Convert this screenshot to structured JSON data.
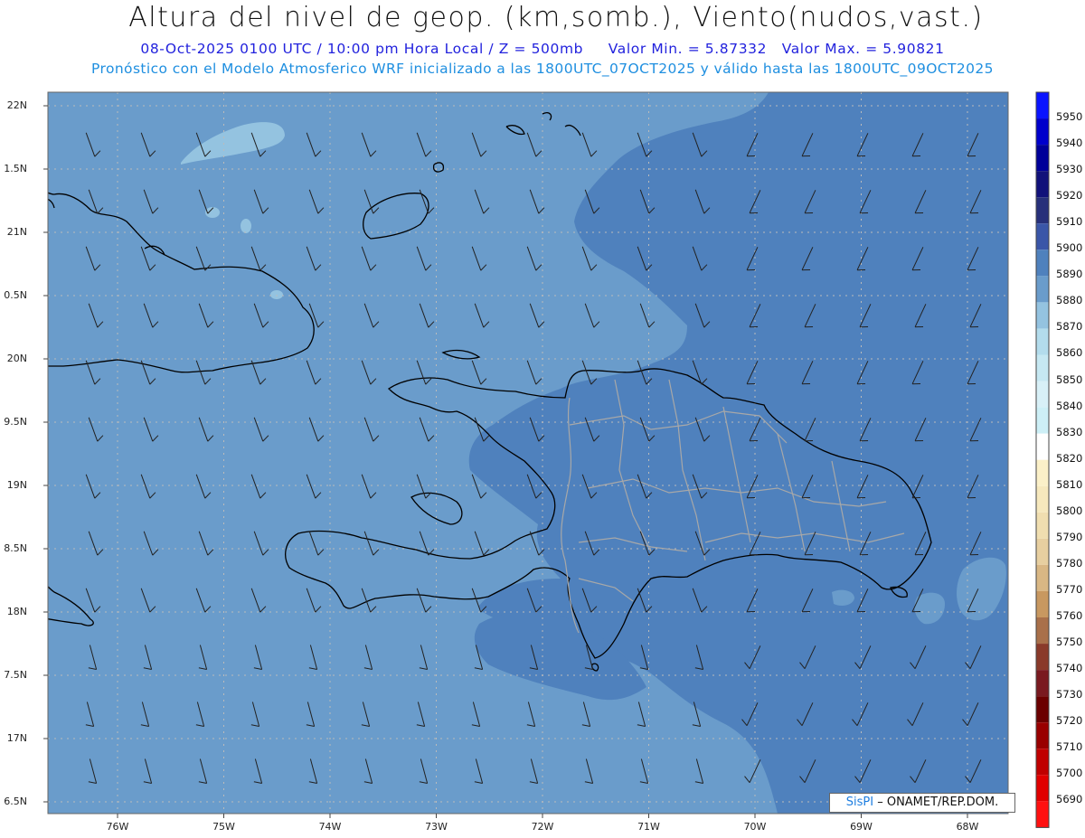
{
  "header": {
    "title": "Altura del nivel de geop. (km,somb.), Viento(nudos,vast.)",
    "date_utc": "08-Oct-2025  0100 UTC",
    "local_time": "/ 10:00 pm Hora Local / Z = 500mb",
    "min_value": "Valor Min. = 5.87332",
    "max_value": "Valor Max. = 5.90821",
    "model_line": "Pronóstico con el Modelo Atmosferico WRF inicializado a las 1800UTC_07OCT2025 y válido hasta las  1800UTC_09OCT2025"
  },
  "map": {
    "lat_labels": [
      "22N",
      "1.5N",
      "21N",
      "0.5N",
      "20N",
      "9.5N",
      "19N",
      "8.5N",
      "18N",
      "7.5N",
      "17N",
      "6.5N"
    ],
    "lon_labels": [
      "76W",
      "75W",
      "74W",
      "73W",
      "72W",
      "71W",
      "70W",
      "69W",
      "68W"
    ],
    "colors": {
      "field_5880": "#6a9ccb",
      "field_5890": "#4f81bd",
      "field_5870": "#94c3e0",
      "coast": "#000000",
      "provinces": "#a8a8a8"
    }
  },
  "colorbar": {
    "levels": [
      {
        "value": "5950",
        "color": "#0a14ff"
      },
      {
        "value": "5940",
        "color": "#0000cc"
      },
      {
        "value": "5930",
        "color": "#000099"
      },
      {
        "value": "5920",
        "color": "#11117a"
      },
      {
        "value": "5910",
        "color": "#27307a"
      },
      {
        "value": "5900",
        "color": "#3a56a8"
      },
      {
        "value": "5890",
        "color": "#4f81bd"
      },
      {
        "value": "5880",
        "color": "#6a9ccb"
      },
      {
        "value": "5870",
        "color": "#94c3e0"
      },
      {
        "value": "5860",
        "color": "#b3dcec"
      },
      {
        "value": "5850",
        "color": "#c6e8f2"
      },
      {
        "value": "5840",
        "color": "#d8f0f7"
      },
      {
        "value": "5830",
        "color": "#cdeff6"
      },
      {
        "value": "5820",
        "color": "#ffffff"
      },
      {
        "value": "5810",
        "color": "#fbf0c8"
      },
      {
        "value": "5800",
        "color": "#f6e8bd"
      },
      {
        "value": "5790",
        "color": "#f0deb0"
      },
      {
        "value": "5780",
        "color": "#e7cfa0"
      },
      {
        "value": "5770",
        "color": "#d9b784"
      },
      {
        "value": "5760",
        "color": "#c89860"
      },
      {
        "value": "5750",
        "color": "#a9704a"
      },
      {
        "value": "5740",
        "color": "#8a3a2a"
      },
      {
        "value": "5730",
        "color": "#7a1a20"
      },
      {
        "value": "5720",
        "color": "#6b0000"
      },
      {
        "value": "5710",
        "color": "#990000"
      },
      {
        "value": "5700",
        "color": "#c00000"
      },
      {
        "value": "5690",
        "color": "#e00000"
      },
      {
        "value": "",
        "color": "#ff1010"
      }
    ]
  },
  "credit": {
    "brand": "SisPI",
    "text": "– ONAMET/REP.DOM."
  }
}
